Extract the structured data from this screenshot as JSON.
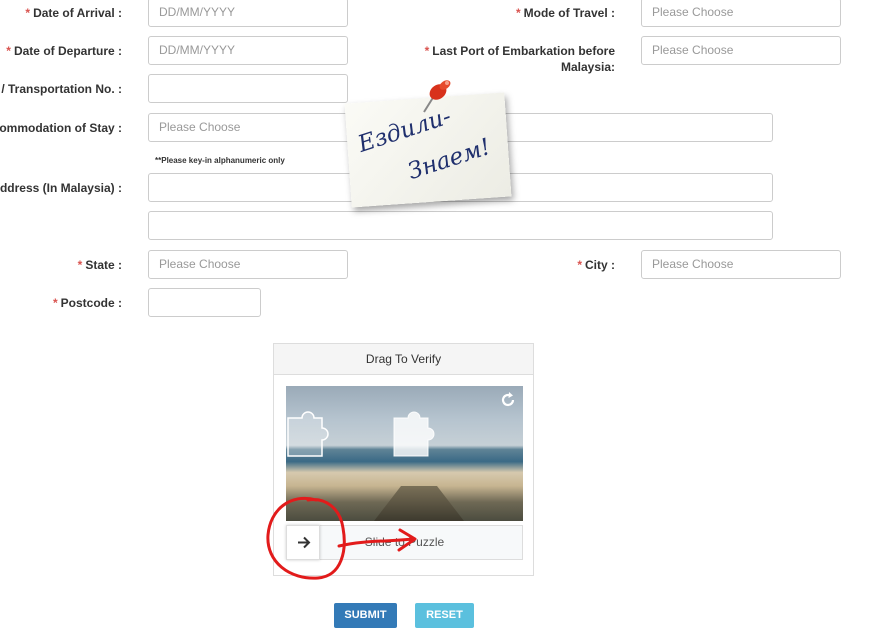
{
  "form": {
    "arrival": {
      "label": "Date of Arrival :",
      "placeholder": "DD/MM/YYYY"
    },
    "departure": {
      "label": "Date of Departure :",
      "placeholder": "DD/MM/YYYY"
    },
    "transport_no": {
      "label": "/ Transportation No. :",
      "value": ""
    },
    "accommodation": {
      "label": "ommodation of Stay :",
      "value": "Please Choose"
    },
    "alnum_hint": "**Please key-in alphanumeric only",
    "address": {
      "label": "ddress (In Malaysia) :",
      "line1": "",
      "line2": ""
    },
    "state": {
      "label": "State :",
      "value": "Please Choose"
    },
    "postcode": {
      "label": "Postcode :",
      "value": ""
    },
    "mode_of_travel": {
      "label": "Mode of Travel :",
      "value": "Please Choose"
    },
    "last_port": {
      "label_line1": "Last Port of Embarkation before",
      "label_line2": "Malaysia:",
      "value": "Please Choose"
    },
    "city": {
      "label": "City :",
      "value": "Please Choose"
    },
    "required_mark": "*"
  },
  "captcha": {
    "title": "Drag To Verify",
    "slider_text": "Slide to Puzzle",
    "slider_icon": "arrow-right-icon",
    "refresh_icon": "refresh-icon"
  },
  "buttons": {
    "submit": "SUBMIT",
    "reset": "RESET"
  },
  "sticker": {
    "text_line1": "Ездили-",
    "text_line2": "Знаем!"
  },
  "colors": {
    "required": "#d9534f",
    "submit": "#337ab7",
    "reset": "#5bc0de",
    "annotation": "#e21b1b"
  }
}
